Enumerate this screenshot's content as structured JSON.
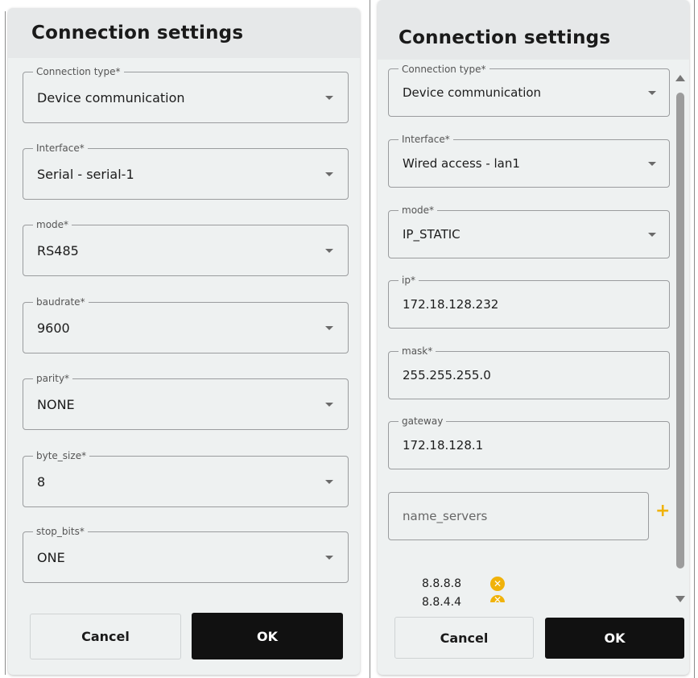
{
  "colors": {
    "accent": "#f0b20a",
    "ok_bg": "#111111",
    "panel_bg": "#eef1f1"
  },
  "left": {
    "title": "Connection settings",
    "fields": [
      {
        "label": "Connection type*",
        "value": "Device communication"
      },
      {
        "label": "Interface*",
        "value": "Serial - serial-1"
      },
      {
        "label": "mode*",
        "value": "RS485"
      },
      {
        "label": "baudrate*",
        "value": "9600"
      },
      {
        "label": "parity*",
        "value": "NONE"
      },
      {
        "label": "byte_size*",
        "value": "8"
      },
      {
        "label": "stop_bits*",
        "value": "ONE"
      }
    ],
    "cancel_label": "Cancel",
    "ok_label": "OK"
  },
  "right": {
    "title": "Connection settings",
    "fields": [
      {
        "label": "Connection type*",
        "value": "Device communication"
      },
      {
        "label": "Interface*",
        "value": "Wired access - lan1"
      },
      {
        "label": "mode*",
        "value": "IP_STATIC"
      },
      {
        "label": "ip*",
        "value": "172.18.128.232"
      },
      {
        "label": "mask*",
        "value": "255.255.255.0"
      },
      {
        "label": "gateway",
        "value": "172.18.128.1"
      }
    ],
    "name_servers_placeholder": "name_servers",
    "name_servers": [
      "8.8.8.8",
      "8.8.4.4"
    ],
    "plus_icon": "plus-icon",
    "remove_icon": "close-circle-icon",
    "cancel_label": "Cancel",
    "ok_label": "OK"
  }
}
